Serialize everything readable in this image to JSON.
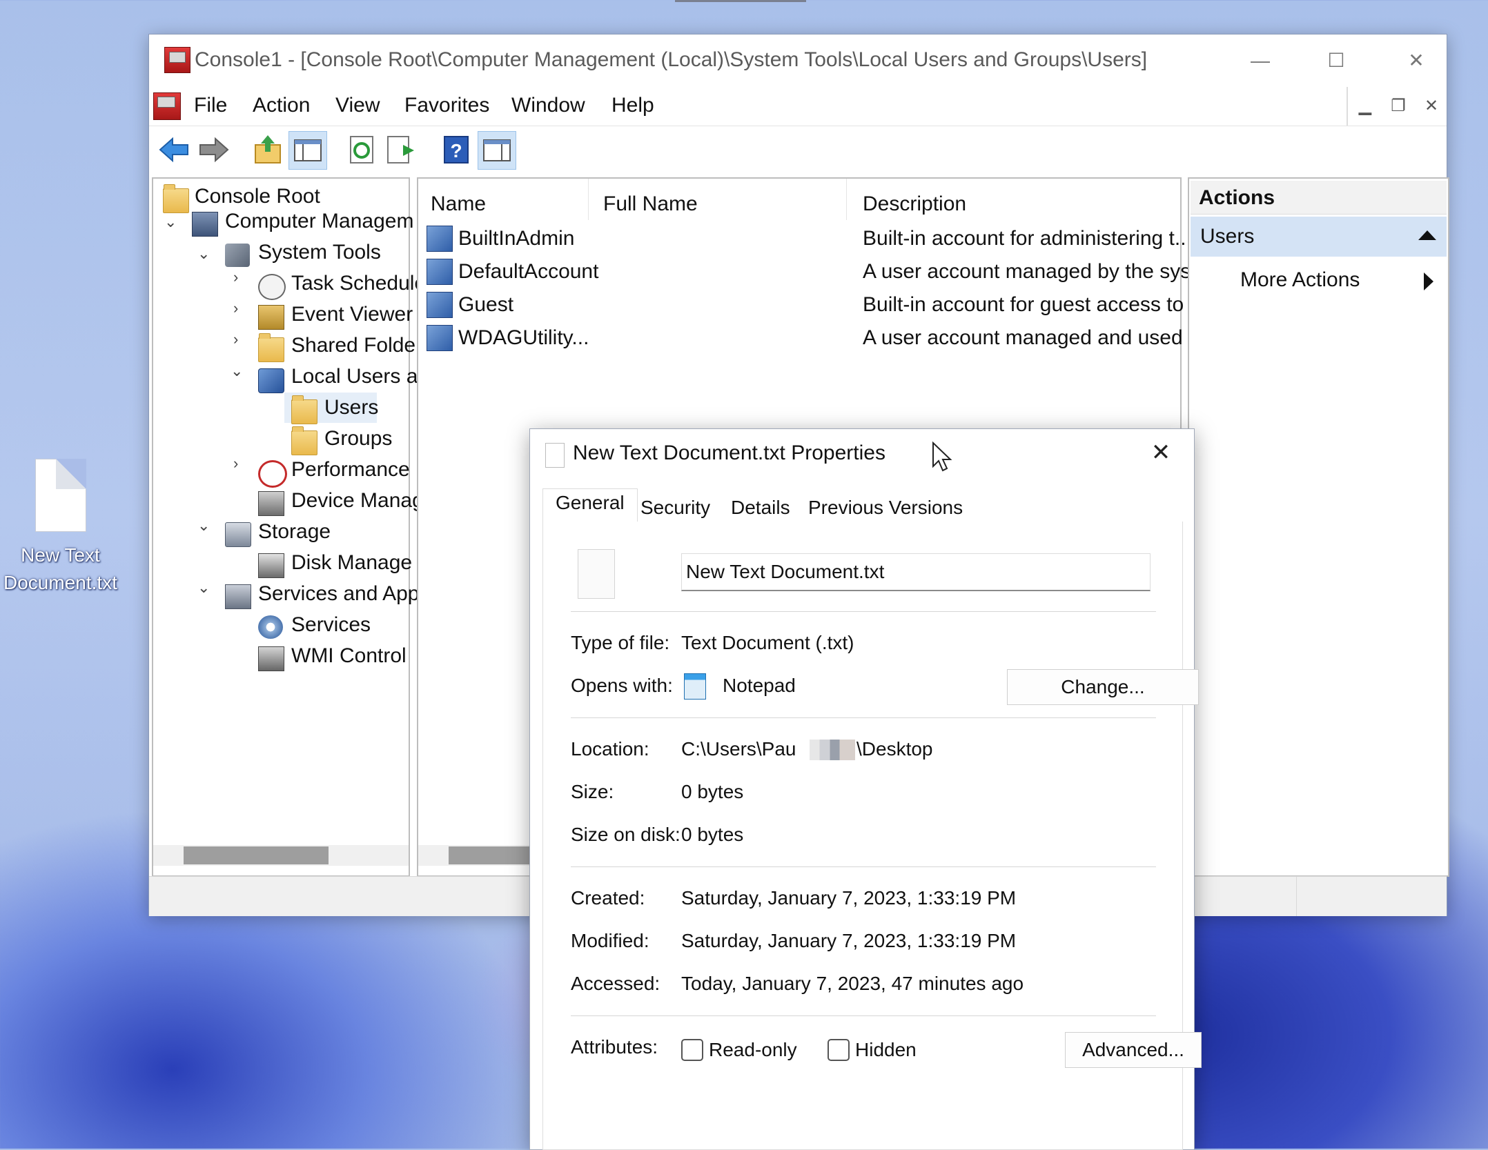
{
  "desktop": {
    "icon_label_line1": "New Text",
    "icon_label_line2": "Document.txt"
  },
  "window": {
    "title": "Console1 - [Console Root\\Computer Management (Local)\\System Tools\\Local Users and Groups\\Users]",
    "minimize": "—",
    "maximize": "☐",
    "close": "✕",
    "menu": [
      "File",
      "Action",
      "View",
      "Favorites",
      "Window",
      "Help"
    ]
  },
  "tree": {
    "items": [
      {
        "label": "Console Root"
      },
      {
        "label": "Computer Managem"
      },
      {
        "label": "System Tools"
      },
      {
        "label": "Task Schedule"
      },
      {
        "label": "Event Viewer"
      },
      {
        "label": "Shared Folde"
      },
      {
        "label": "Local Users a"
      },
      {
        "label": "Users"
      },
      {
        "label": "Groups"
      },
      {
        "label": "Performance"
      },
      {
        "label": "Device Manag"
      },
      {
        "label": "Storage"
      },
      {
        "label": "Disk Manage"
      },
      {
        "label": "Services and App"
      },
      {
        "label": "Services"
      },
      {
        "label": "WMI Control"
      }
    ]
  },
  "list": {
    "columns": [
      "Name",
      "Full Name",
      "Description"
    ],
    "rows": [
      {
        "name": "BuiltInAdmin",
        "full_name": "",
        "description": "Built-in account for administering t..."
      },
      {
        "name": "DefaultAccount",
        "full_name": "",
        "description": "A user account managed by the syst..."
      },
      {
        "name": "Guest",
        "full_name": "",
        "description": "Built-in account for guest access to ..."
      },
      {
        "name": "WDAGUtility...",
        "full_name": "",
        "description": "A user account managed and used ..."
      }
    ]
  },
  "actions": {
    "header": "Actions",
    "section": "Users",
    "more": "More Actions"
  },
  "dialog": {
    "title": "New Text Document.txt Properties",
    "close": "✕",
    "tabs": [
      "General",
      "Security",
      "Details",
      "Previous Versions"
    ],
    "file_name": "New Text Document.txt",
    "type_label": "Type of file:",
    "type_value": "Text Document (.txt)",
    "opens_label": "Opens with:",
    "opens_value": "Notepad",
    "change_button": "Change...",
    "location_label": "Location:",
    "location_prefix": "C:\\Users\\Pau",
    "location_suffix": "\\Desktop",
    "size_label": "Size:",
    "size_value": "0 bytes",
    "disk_label": "Size on disk:",
    "disk_value": "0 bytes",
    "created_label": "Created:",
    "created_value": "Saturday, January 7, 2023, 1:33:19 PM",
    "modified_label": "Modified:",
    "modified_value": "Saturday, January 7, 2023, 1:33:19 PM",
    "accessed_label": "Accessed:",
    "accessed_value": "Today, January 7, 2023, 47 minutes ago",
    "attributes_label": "Attributes:",
    "readonly_label": "Read-only",
    "hidden_label": "Hidden",
    "advanced_button": "Advanced..."
  }
}
